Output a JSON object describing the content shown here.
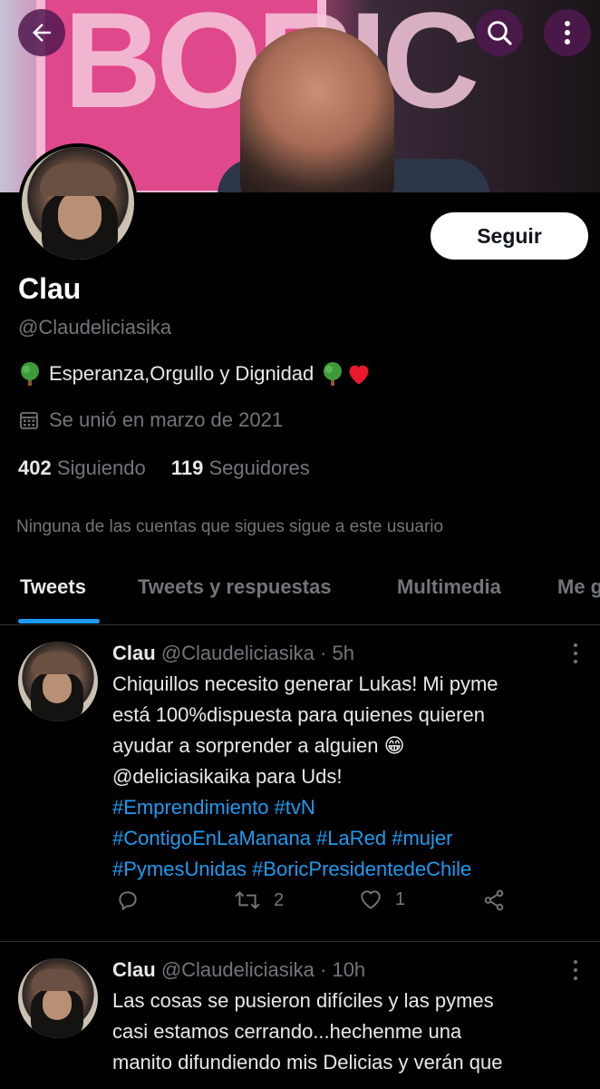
{
  "header": {
    "banner_text": "BORIC",
    "back_icon": "arrow-left-icon",
    "search_icon": "search-icon",
    "more_icon": "more-vertical-icon"
  },
  "profile": {
    "follow_label": "Seguir",
    "name": "Clau",
    "handle": "@Claudeliciasika",
    "bio": "Esperanza,Orgullo y Dignidad",
    "joined": "Se unió en marzo de 2021",
    "following_count": "402",
    "following_label": "Siguiendo",
    "followers_count": "119",
    "followers_label": "Seguidores",
    "mutuals_note": "Ninguna de las cuentas que sigues sigue a este usuario"
  },
  "tabs": [
    {
      "label": "Tweets"
    },
    {
      "label": "Tweets y respuestas"
    },
    {
      "label": "Multimedia"
    },
    {
      "label": "Me g"
    }
  ],
  "tweets": [
    {
      "name": "Clau",
      "handle": "@Claudeliciasika",
      "time": "· 5h",
      "line1": "Chiquillos necesito generar Lukas! Mi pyme",
      "line2": "está 100%dispuesta para quienes quieren",
      "line3": "ayudar a sorprender a alguien 😁",
      "line4": "@deliciasikaika para Uds!",
      "tags1": "#Emprendimiento #tvN",
      "tags2": "#ContigoEnLaManana #LaRed #mujer",
      "tags3": "#PymesUnidas #BoricPresidentedeChile",
      "retweets": "2",
      "likes": "1"
    },
    {
      "name": "Clau",
      "handle": "@Claudeliciasika",
      "time": "· 10h",
      "line1": "Las cosas se pusieron difíciles y las pymes",
      "line2": "casi estamos cerrando...hechenme una",
      "line3": "manito difundiendo mis Delicias y verán que"
    }
  ],
  "colors": {
    "accent": "#1d9bf0",
    "background": "#000000",
    "muted": "#71767b",
    "overlay_button": "#501950"
  }
}
